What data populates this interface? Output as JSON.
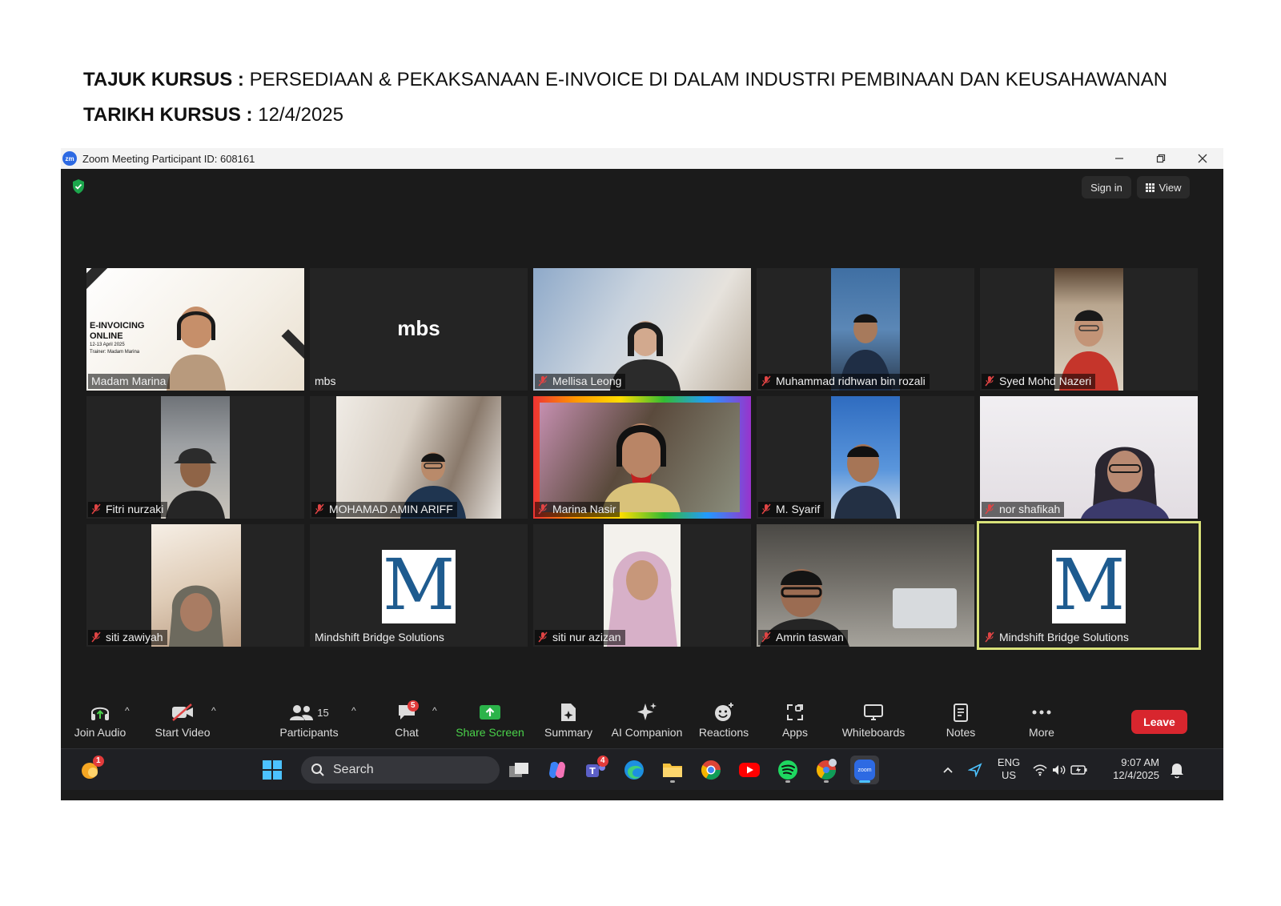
{
  "document": {
    "course_title_label": "TAJUK KURSUS :",
    "course_title_value": "PERSEDIAAN & PEKAKSANAAN E-INVOICE DI DALAM INDUSTRI PEMBINAAN DAN KEUSAHAWANAN",
    "course_date_label": "TARIKH KURSUS :",
    "course_date_value": "12/4/2025"
  },
  "window": {
    "title": "Zoom Meeting Participant ID: 608161",
    "logo_text": "zm"
  },
  "top_controls": {
    "sign_in_label": "Sign in",
    "view_label": "View"
  },
  "participants": [
    {
      "name": "Madam Marina",
      "muted": false,
      "banner_lines": [
        "E-INVOICING",
        "ONLINE",
        "12-13 April 2025",
        "Trainer: Madam Marina"
      ]
    },
    {
      "name": "mbs",
      "muted": false,
      "logo_text": "mbs"
    },
    {
      "name": "Mellisa Leong",
      "muted": true
    },
    {
      "name": "Muhammad ridhwan bin rozali",
      "muted": true
    },
    {
      "name": "Syed Mohd Nazeri",
      "muted": true
    },
    {
      "name": "Fitri nurzaki",
      "muted": true
    },
    {
      "name": "MOHAMAD AMIN ARIFF",
      "muted": true
    },
    {
      "name": "Marina Nasir",
      "muted": true
    },
    {
      "name": "M. Syarif",
      "muted": true
    },
    {
      "name": "nor shafikah",
      "muted": true
    },
    {
      "name": "siti zawiyah",
      "muted": true
    },
    {
      "name": "Mindshift Bridge Solutions",
      "muted": false,
      "logo_text": "M"
    },
    {
      "name": "siti nur azizan",
      "muted": true
    },
    {
      "name": "Amrin taswan",
      "muted": true
    },
    {
      "name": "Mindshift Bridge Solutions",
      "muted": true,
      "logo_text": "M",
      "active_speaker": true
    }
  ],
  "toolbar": {
    "join_audio": "Join Audio",
    "start_video": "Start Video",
    "participants": "Participants",
    "participants_count": "15",
    "chat": "Chat",
    "chat_badge": "5",
    "share_screen": "Share Screen",
    "summary": "Summary",
    "ai_companion": "AI Companion",
    "reactions": "Reactions",
    "apps": "Apps",
    "whiteboards": "Whiteboards",
    "notes": "Notes",
    "more": "More",
    "leave": "Leave"
  },
  "taskbar": {
    "notification_badge": "1",
    "search_label": "Search",
    "teams_badge": "4",
    "language_line1": "ENG",
    "language_line2": "US",
    "time": "9:07 AM",
    "date": "12/4/2025",
    "zoom_label": "zoom"
  },
  "colors": {
    "share_green": "#4ad24a",
    "leave_red": "#d8262e",
    "active_speaker_border": "#d9e27a",
    "mindshift_blue": "#1e5b8f"
  }
}
